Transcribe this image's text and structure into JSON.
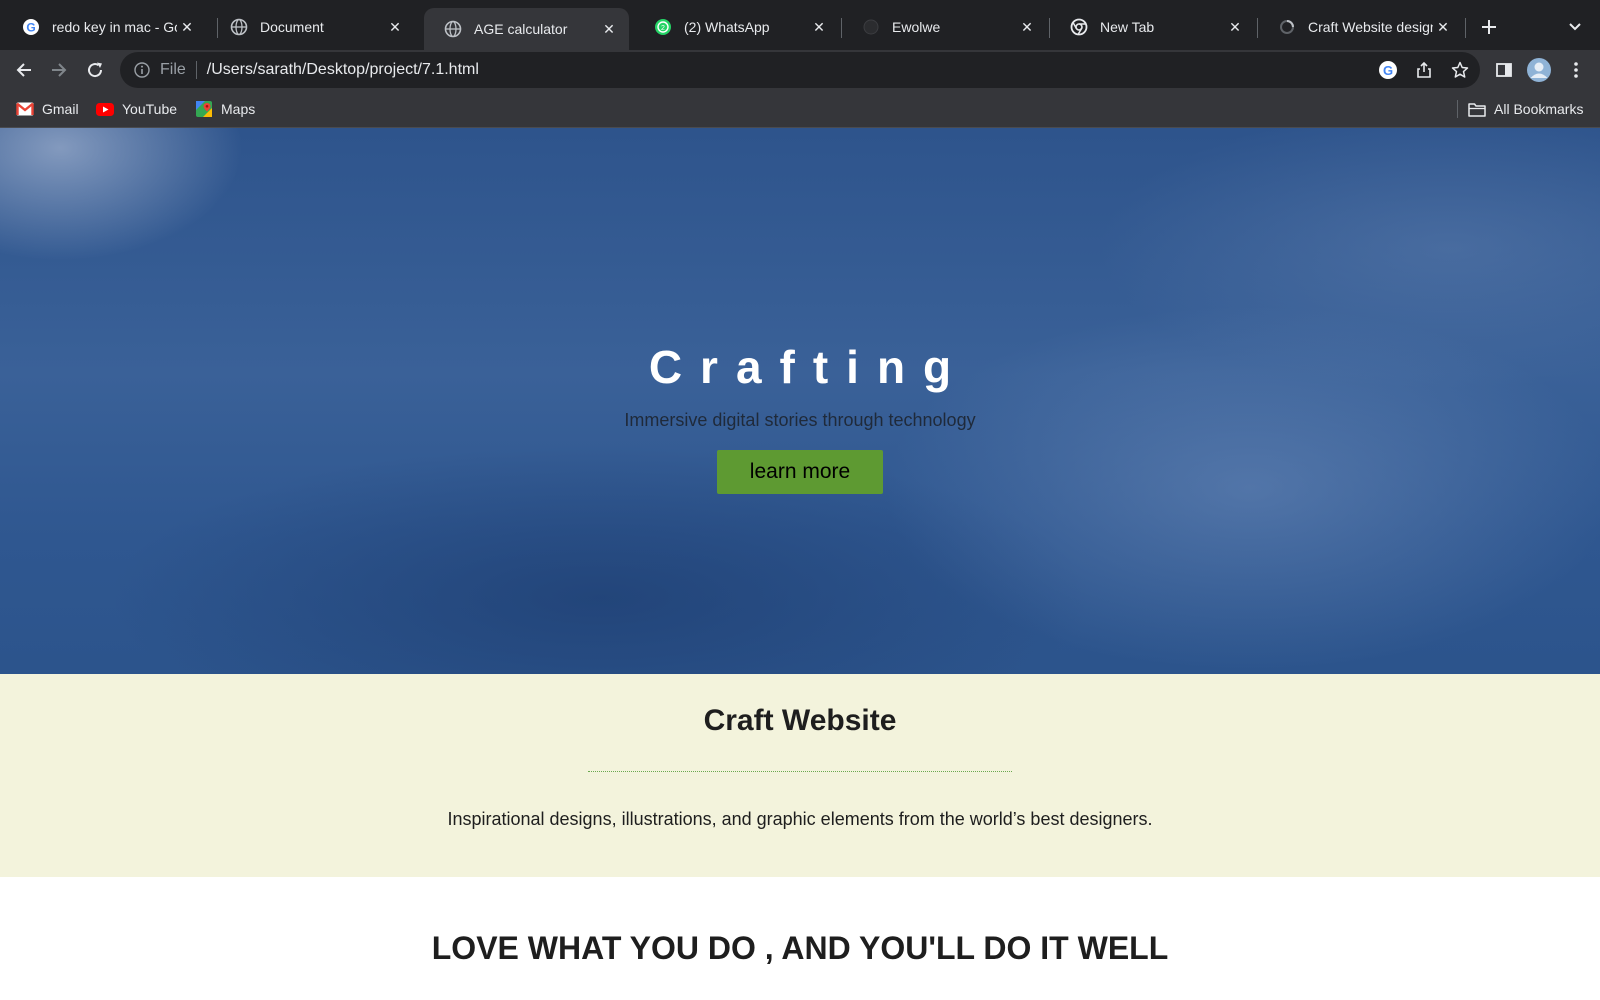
{
  "browser": {
    "tabs": [
      {
        "title": "redo key in mac - Go",
        "icon": "google-icon",
        "active": false
      },
      {
        "title": "Document",
        "icon": "globe-icon",
        "active": false
      },
      {
        "title": "AGE calculator",
        "icon": "globe-icon",
        "active": true
      },
      {
        "title": "(2) WhatsApp",
        "icon": "whatsapp-icon",
        "active": false
      },
      {
        "title": "Ewolwe",
        "icon": "dark-circle-icon",
        "active": false
      },
      {
        "title": "New Tab",
        "icon": "chrome-icon",
        "active": false
      },
      {
        "title": "Craft Website design",
        "icon": "loading-icon",
        "active": false
      }
    ],
    "omnibox": {
      "scheme": "File",
      "url": "/Users/sarath/Desktop/project/7.1.html"
    },
    "bookmarks": [
      {
        "label": "Gmail",
        "icon": "gmail-icon"
      },
      {
        "label": "YouTube",
        "icon": "youtube-icon"
      },
      {
        "label": "Maps",
        "icon": "maps-icon"
      }
    ],
    "all_bookmarks": "All Bookmarks",
    "colors": {
      "tabstrip": "#202124",
      "toolbar": "#35363a",
      "text": "#e8eaed"
    }
  },
  "page": {
    "hero": {
      "title": "Crafting",
      "subtitle": "Immersive digital stories through technology",
      "button": "learn more"
    },
    "about": {
      "title": "Craft Website",
      "text": "Inspirational designs, illustrations, and graphic elements from the world’s best designers."
    },
    "motto": "LOVE WHAT YOU DO , AND YOU'LL DO IT WELL",
    "colors": {
      "hero_bg": "#36598f",
      "button_bg": "#5e9a32",
      "about_bg": "#f3f3dc",
      "rule": "#6aa84f"
    }
  }
}
